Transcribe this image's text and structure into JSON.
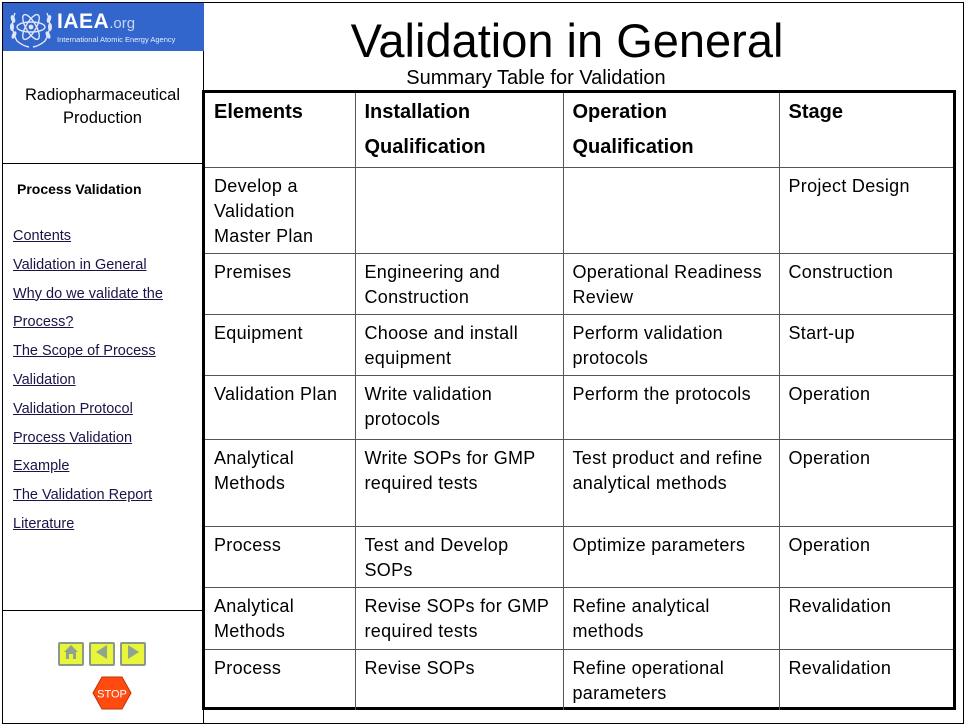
{
  "logo": {
    "main": "IAEA",
    "domain": ".org",
    "subtitle": "International Atomic Energy Agency",
    "color": "#3366cc"
  },
  "sidebar": {
    "course_title_line1": "Radiopharmaceutical",
    "course_title_line2": "Production",
    "section_heading": "Process Validation",
    "links": [
      "Contents",
      "Validation in General",
      "Why do we validate the",
      "Process?",
      "The Scope of Process",
      "Validation",
      "Validation Protocol",
      "Process Validation",
      "Example",
      "The Validation Report",
      "Literature"
    ],
    "controls": {
      "home_icon": "home-icon",
      "back_icon": "arrow-left-icon",
      "forward_icon": "arrow-right-icon",
      "stop_label": "STOP",
      "button_color": "#e9f53a",
      "stop_color": "#ff4a10"
    }
  },
  "main": {
    "title": "Validation in General",
    "subtitle": "Summary Table for Validation",
    "table": {
      "headers": [
        [
          "Elements"
        ],
        [
          "Installation",
          "Qualification"
        ],
        [
          "Operation",
          "Qualification"
        ],
        [
          "Stage"
        ]
      ],
      "rows": [
        [
          "Develop a Validation Master Plan",
          "",
          "",
          "Project Design"
        ],
        [
          "Premises",
          "Engineering and Construction",
          "Operational Readiness Review",
          "Construction"
        ],
        [
          "Equipment",
          "Choose and install equipment",
          "Perform validation protocols",
          "Start-up"
        ],
        [
          "Validation Plan",
          "Write validation protocols",
          "Perform the protocols",
          "Operation"
        ],
        [
          "Analytical Methods",
          "Write SOPs for GMP required tests",
          "Test product and refine analytical methods",
          "Operation"
        ],
        [
          "Process",
          "Test and Develop SOPs",
          "Optimize parameters",
          "Operation"
        ],
        [
          "Analytical Methods",
          "Revise SOPs for GMP required tests",
          "Refine analytical methods",
          "Revalidation"
        ],
        [
          "Process",
          "Revise SOPs",
          "Refine operational parameters",
          "Revalidation"
        ]
      ]
    }
  }
}
